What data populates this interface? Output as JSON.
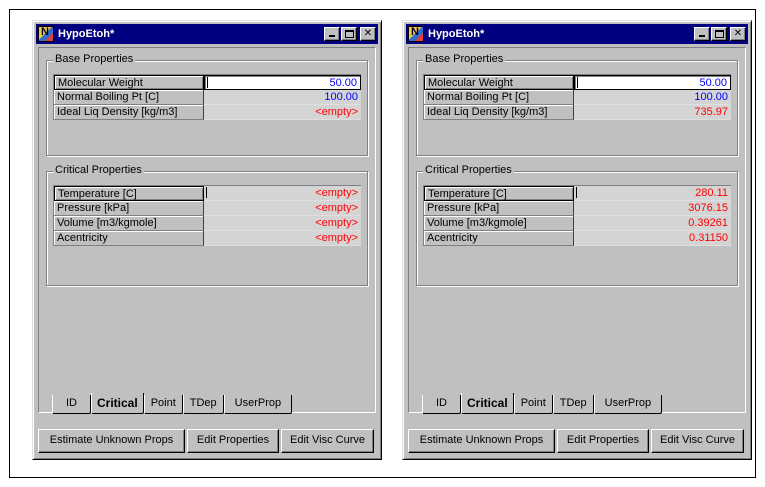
{
  "windows": [
    {
      "title": "HypoEtoh*",
      "base_group": {
        "label": "Base Properties",
        "rows": [
          {
            "label": "Molecular Weight",
            "value": "50.00",
            "color": "blue"
          },
          {
            "label": "Normal Boiling Pt [C]",
            "value": "100.00",
            "color": "blue"
          },
          {
            "label": "Ideal Liq Density [kg/m3]",
            "value": "<empty>",
            "color": "red"
          }
        ]
      },
      "critical_group": {
        "label": "Critical Properties",
        "rows": [
          {
            "label": "Temperature [C]",
            "value": "<empty>",
            "color": "red"
          },
          {
            "label": "Pressure [kPa]",
            "value": "<empty>",
            "color": "red"
          },
          {
            "label": "Volume [m3/kgmole]",
            "value": "<empty>",
            "color": "red"
          },
          {
            "label": "Acentricity",
            "value": "<empty>",
            "color": "red"
          }
        ]
      },
      "tabs": [
        "ID",
        "Critical",
        "Point",
        "TDep",
        "UserProp"
      ],
      "active_tab": "Critical",
      "buttons": [
        "Estimate Unknown Props",
        "Edit Properties",
        "Edit Visc Curve"
      ]
    },
    {
      "title": "HypoEtoh*",
      "base_group": {
        "label": "Base Properties",
        "rows": [
          {
            "label": "Molecular Weight",
            "value": "50.00",
            "color": "blue"
          },
          {
            "label": "Normal Boiling Pt [C]",
            "value": "100.00",
            "color": "blue"
          },
          {
            "label": "Ideal Liq Density [kg/m3]",
            "value": "735.97",
            "color": "red"
          }
        ]
      },
      "critical_group": {
        "label": "Critical Properties",
        "rows": [
          {
            "label": "Temperature [C]",
            "value": "280.11",
            "color": "red"
          },
          {
            "label": "Pressure [kPa]",
            "value": "3076.15",
            "color": "red"
          },
          {
            "label": "Volume [m3/kgmole]",
            "value": "0.39261",
            "color": "red"
          },
          {
            "label": "Acentricity",
            "value": "0.31150",
            "color": "red"
          }
        ]
      },
      "tabs": [
        "ID",
        "Critical",
        "Point",
        "TDep",
        "UserProp"
      ],
      "active_tab": "Critical",
      "buttons": [
        "Estimate Unknown Props",
        "Edit Properties",
        "Edit Visc Curve"
      ]
    }
  ],
  "colors": {
    "title_bar": "#000080",
    "input_value": "#0000ff",
    "calculated_value": "#ff0000",
    "face": "#c0c0c0"
  },
  "icons": {
    "app": "hysys-app-icon",
    "minimize": "minimize-icon",
    "maximize": "maximize-icon",
    "close": "close-icon"
  },
  "title_buttons": {
    "close_glyph": "✕"
  }
}
